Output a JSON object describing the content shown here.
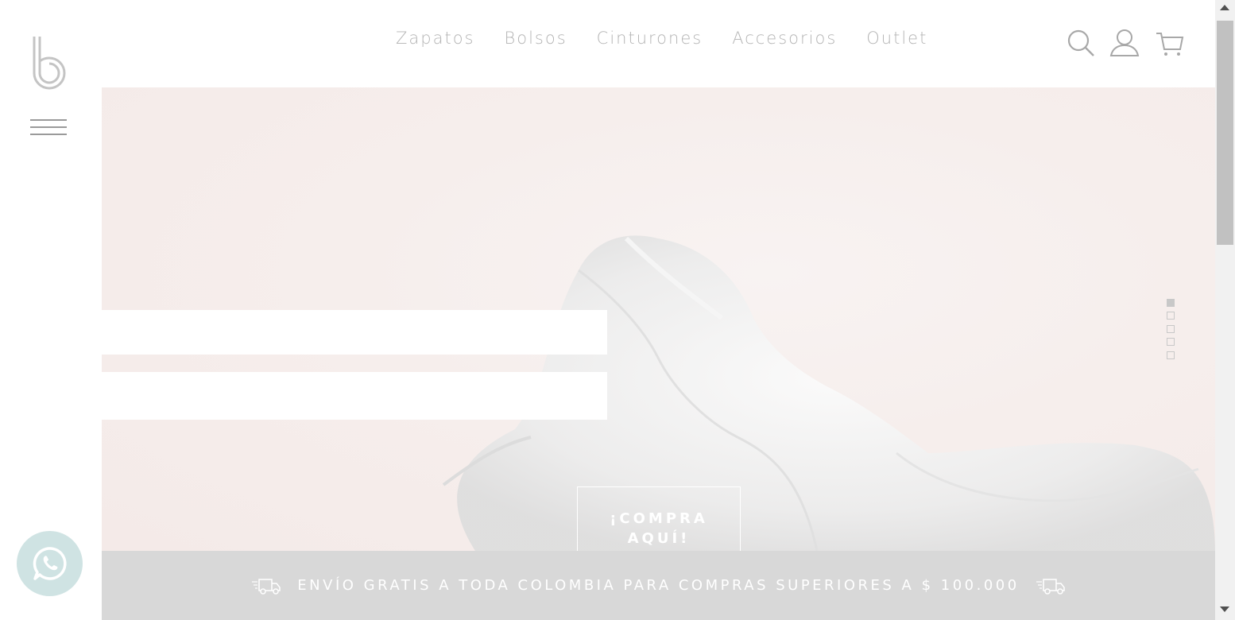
{
  "header": {
    "nav": [
      "Zapatos",
      "Bolsos",
      "Cinturones",
      "Accesorios",
      "Outlet"
    ],
    "icons": [
      "search-icon",
      "user-icon",
      "cart-icon"
    ]
  },
  "sidebar": {
    "logo_icon": "b-logo-icon",
    "menu_icon": "hamburger-menu-icon"
  },
  "hero": {
    "cta_line1": "¡COMPRA",
    "cta_line2": "AQUÍ!",
    "slides_total": 5,
    "active_slide": 1
  },
  "promo": {
    "text": "ENVÍO GRATIS A TODA COLOMBIA PARA COMPRAS SUPERIORES A $ 100.000",
    "icon": "delivery-truck-icon"
  },
  "floating": {
    "whatsapp_icon": "whatsapp-icon"
  },
  "colors": {
    "nav_text": "#b4b4b4",
    "hero_bg": "#f6eeec",
    "promo_bg": "#d8d8d8",
    "whatsapp_bg": "#cfe3e3"
  }
}
